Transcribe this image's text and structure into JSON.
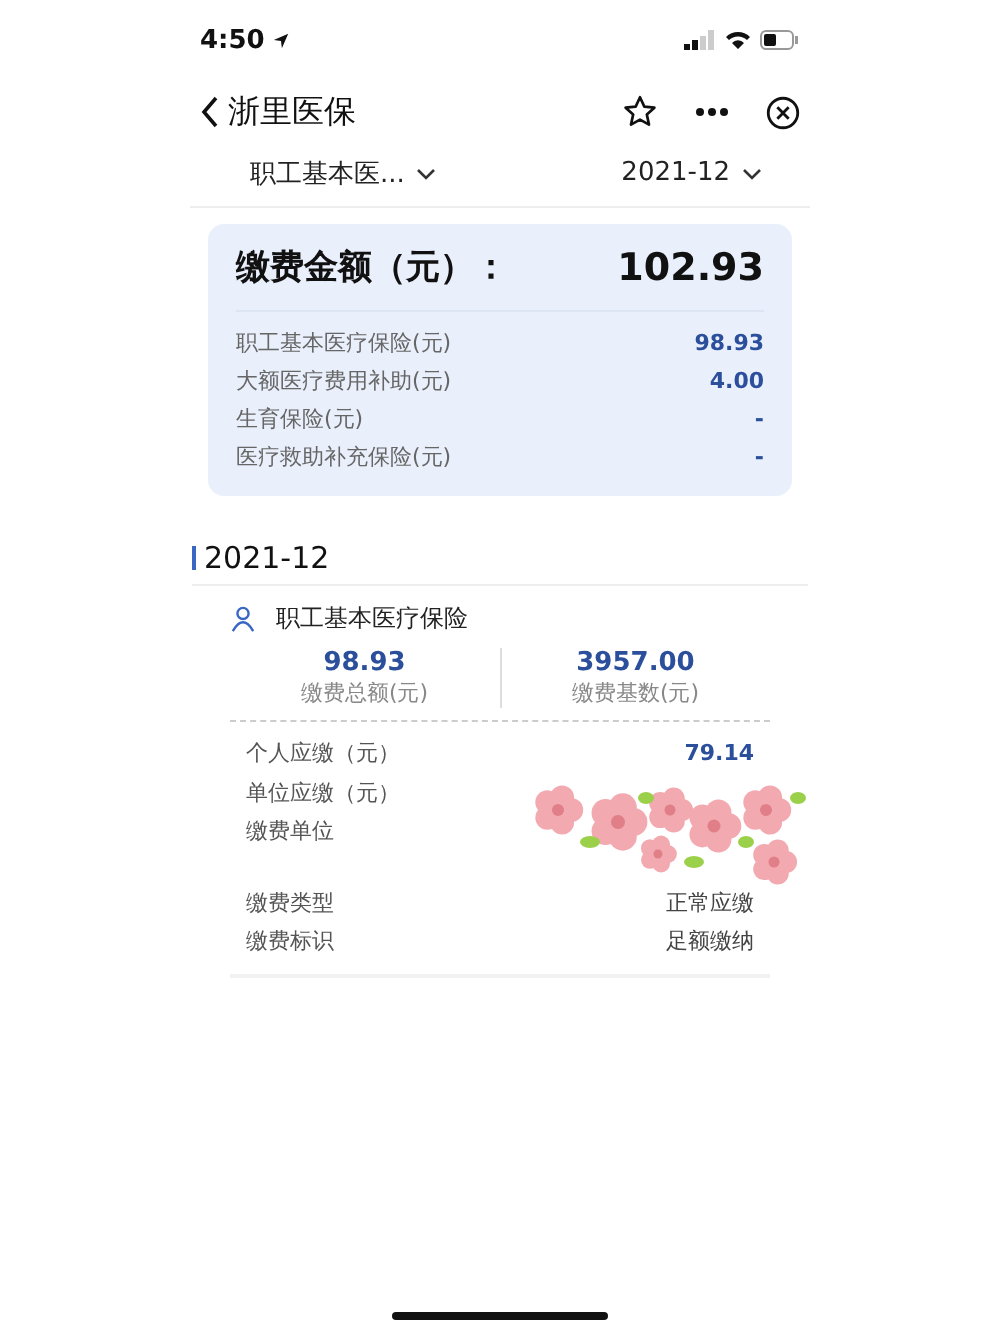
{
  "status_bar": {
    "time": "4:50"
  },
  "nav": {
    "back_label": "浙里医保"
  },
  "filters": [
    {
      "label": "职工基本医..."
    },
    {
      "label": "2021-12"
    }
  ],
  "summary": {
    "title": "缴费金额（元）：",
    "total": "102.93",
    "items": [
      {
        "label": "职工基本医疗保险(元)",
        "value": "98.93"
      },
      {
        "label": "大额医疗费用补助(元)",
        "value": "4.00"
      },
      {
        "label": "生育保险(元)",
        "value": "-"
      },
      {
        "label": "医疗救助补充保险(元)",
        "value": "-"
      }
    ]
  },
  "section": {
    "title": "2021-12",
    "insurance": "职工基本医疗保险",
    "stats": [
      {
        "value": "98.93",
        "label": "缴费总额(元)"
      },
      {
        "value": "3957.00",
        "label": "缴费基数(元)"
      }
    ],
    "details": [
      {
        "label": "个人应缴（元）",
        "value": "79.14",
        "kind": "amount"
      },
      {
        "label": "单位应缴（元）"
      },
      {
        "label": "缴费单位"
      },
      {
        "label": "缴费类型",
        "value": "正常应缴",
        "kind": "text"
      },
      {
        "label": "缴费标识",
        "value": "足额缴纳",
        "kind": "text"
      }
    ]
  }
}
